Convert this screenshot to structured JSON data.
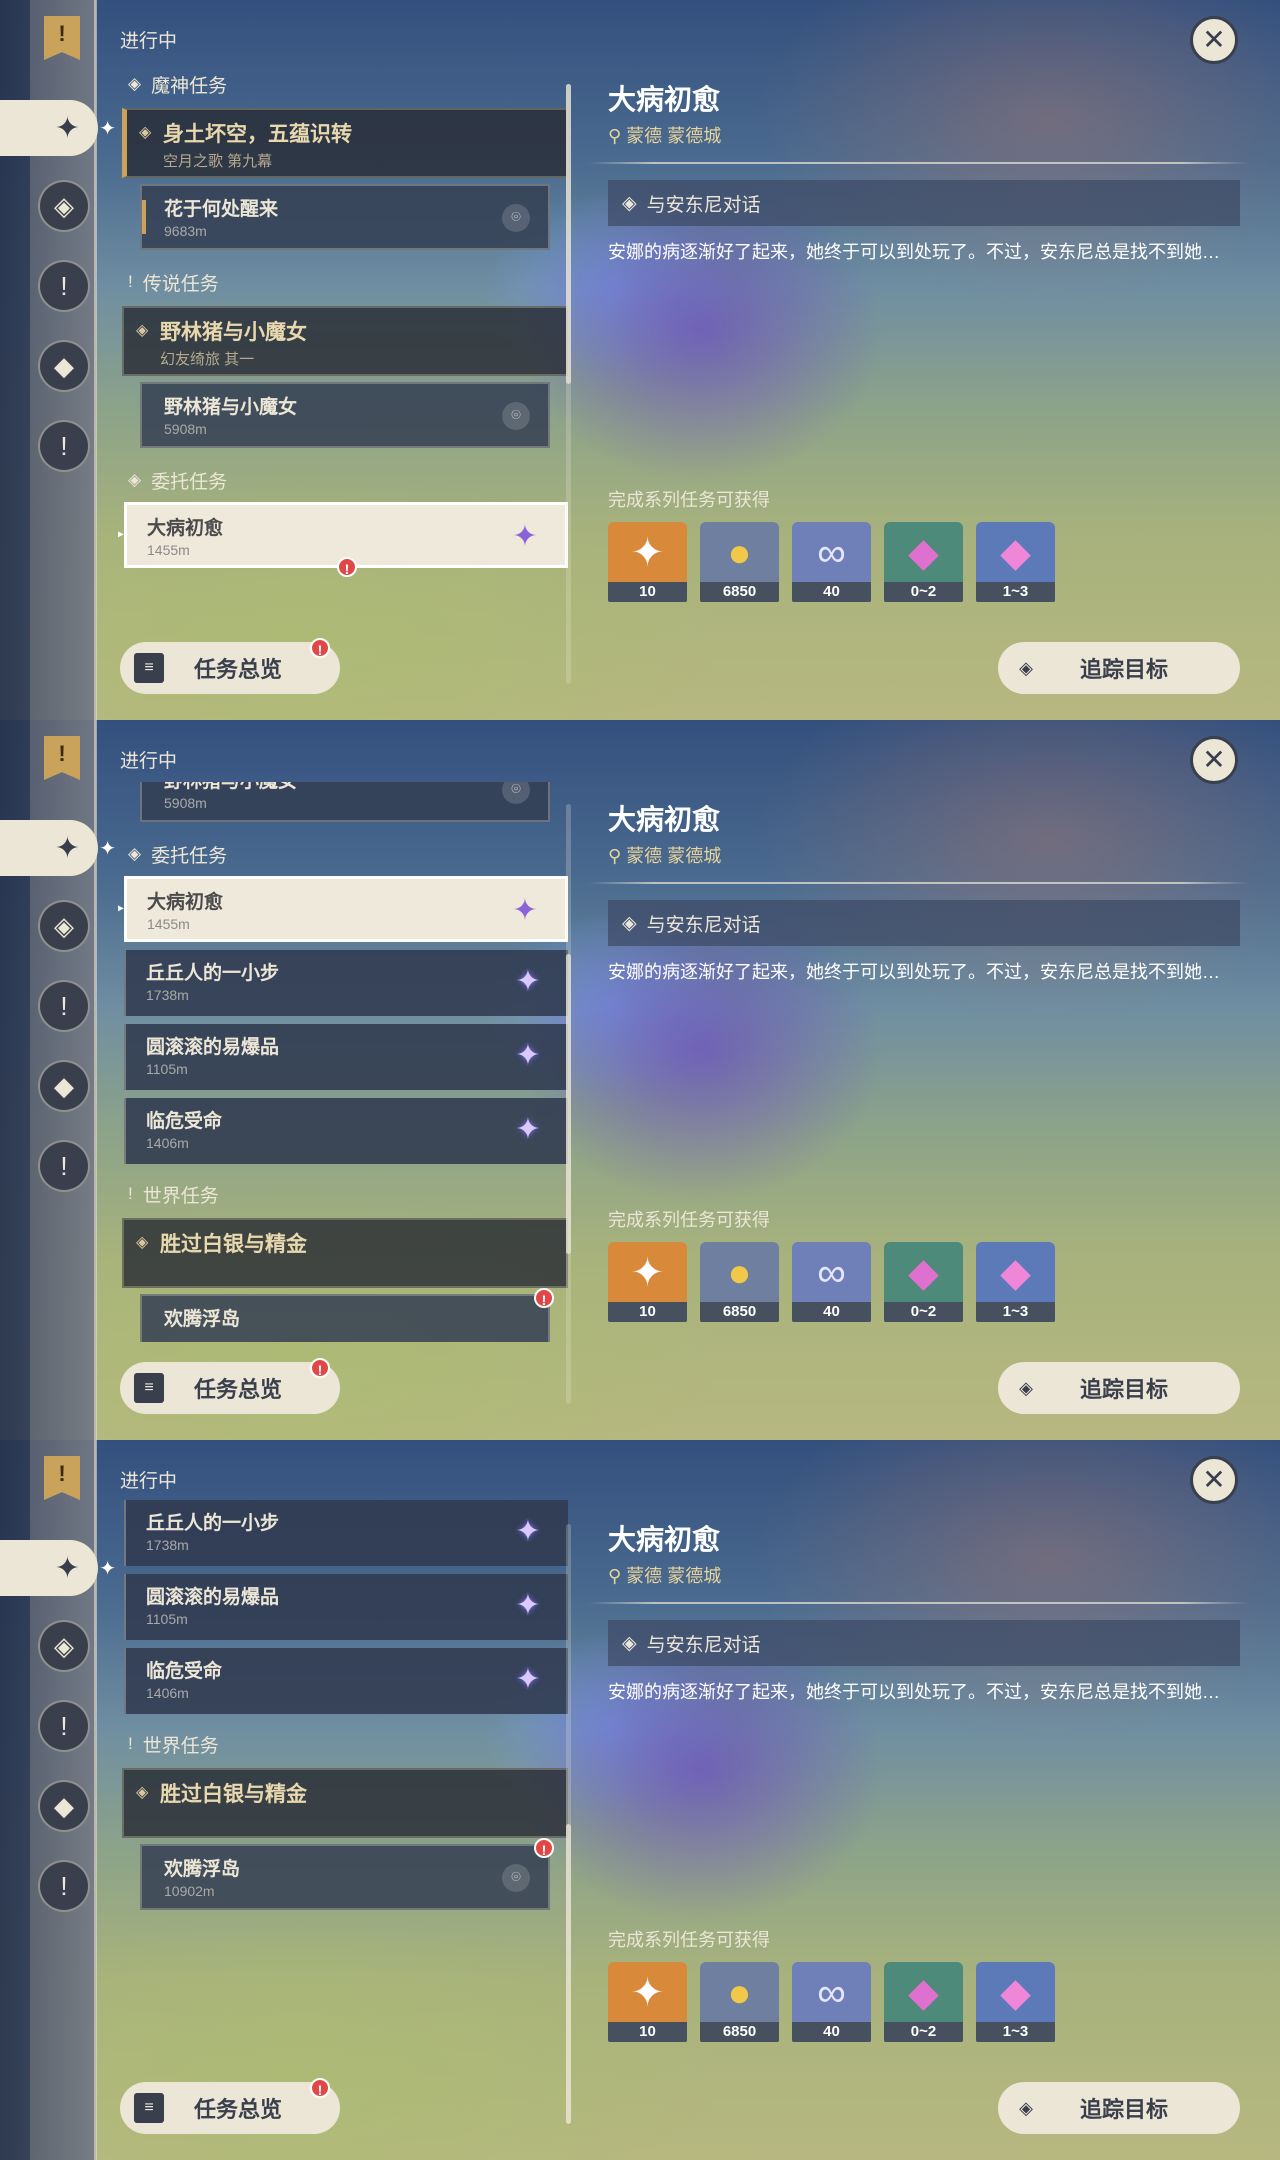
{
  "header": {
    "in_progress": "进行中"
  },
  "categories": {
    "archon": "魔神任务",
    "legend": "传说任务",
    "commission": "委托任务",
    "world": "世界任务"
  },
  "quests": {
    "archon_main": {
      "title": "身土坏空，五蕴识转",
      "subtitle": "空月之歌 第九幕"
    },
    "archon_sub": {
      "title": "花于何处醒来",
      "distance": "9683m"
    },
    "legend_main": {
      "title": "野林猪与小魔女",
      "subtitle": "幻友绮旅 其一"
    },
    "legend_sub": {
      "title": "野林猪与小魔女",
      "distance": "5908m"
    },
    "world_main": {
      "title": "胜过白银与精金"
    },
    "world_sub": {
      "title": "欢腾浮岛",
      "distance": "10902m"
    },
    "world_sub_partial": {
      "title": "欢腾浮岛"
    }
  },
  "commissions": [
    {
      "title": "大病初愈",
      "distance": "1455m"
    },
    {
      "title": "丘丘人的一小步",
      "distance": "1738m"
    },
    {
      "title": "圆滚滚的易爆品",
      "distance": "1105m"
    },
    {
      "title": "临危受命",
      "distance": "1406m"
    }
  ],
  "detail": {
    "title": "大病初愈",
    "location": "蒙德 蒙德城",
    "step": "与安东尼对话",
    "description": "安娜的病逐渐好了起来，她终于可以到处玩了。不过，安东尼总是找不到她…",
    "rewards_label": "完成系列任务可获得",
    "rewards": [
      {
        "icon": "primogem-icon",
        "count": "10",
        "color": "#d9893a"
      },
      {
        "icon": "mora-icon",
        "count": "6850",
        "color": "#6f7fa0"
      },
      {
        "icon": "companionship-exp-icon",
        "count": "40",
        "color": "#6f7fb8"
      },
      {
        "icon": "crystal-chunk-icon",
        "count": "0~2",
        "color": "#4e8a7a"
      },
      {
        "icon": "crystal-cluster-icon",
        "count": "1~3",
        "color": "#5c7ab8"
      }
    ]
  },
  "buttons": {
    "overview": "任务总览",
    "track": "追踪目标",
    "badge": "!"
  },
  "icons": {
    "close": "close-icon",
    "bookmark": "bookmark-icon",
    "pin": "map-pin-icon",
    "star": "commission-star-icon"
  }
}
